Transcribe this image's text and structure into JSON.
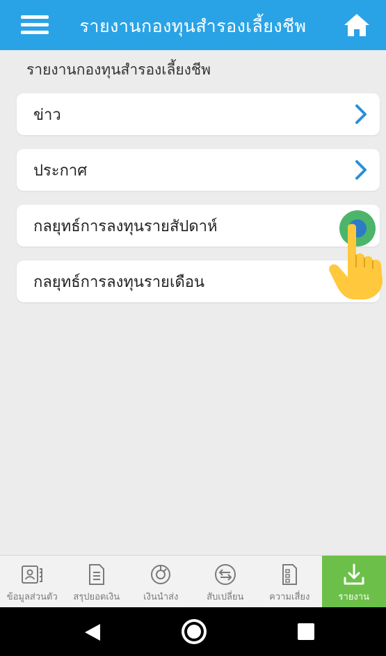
{
  "header": {
    "title": "รายงานกองทุนสำรองเลี้ยงชีพ",
    "bg_color": "#2aa3e6"
  },
  "section_title": "รายงานกองทุนสำรองเลี้ยงชีพ",
  "list": [
    {
      "label": "ข่าว",
      "icon": "chevron-right-icon"
    },
    {
      "label": "ประกาศ",
      "icon": "chevron-right-icon"
    },
    {
      "label": "กลยุทธ์การลงทุนรายสัปดาห์",
      "icon": "touch-indicator-icon"
    },
    {
      "label": "กลยุทธ์การลงทุนรายเดือน",
      "icon": "pointing-hand-icon"
    }
  ],
  "bottom_nav": [
    {
      "label": "ข้อมูลส่วนตัว",
      "icon": "profile-card-icon"
    },
    {
      "label": "สรุปยอดเงิน",
      "icon": "document-icon"
    },
    {
      "label": "เงินนำส่ง",
      "icon": "pie-chart-icon"
    },
    {
      "label": "สับเปลี่ยน",
      "icon": "switch-arrows-icon"
    },
    {
      "label": "ความเสี่ยง",
      "icon": "checklist-icon"
    },
    {
      "label": "รายงาน",
      "icon": "download-icon",
      "active": true
    }
  ],
  "colors": {
    "accent": "#2aa3e6",
    "active_nav": "#6cc04a",
    "chevron": "#2a8fd9"
  }
}
